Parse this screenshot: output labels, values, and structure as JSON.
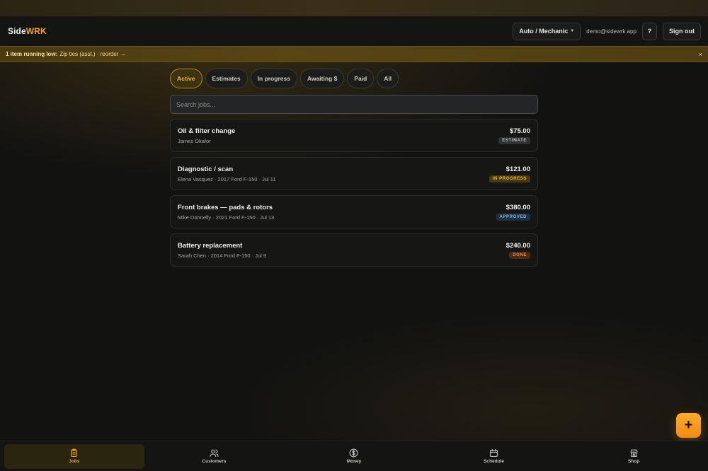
{
  "brand": {
    "part1": "Side",
    "part2": "WRK"
  },
  "header": {
    "trade_label": "Auto / Mechanic",
    "email": "demo@sidewrk.app",
    "help_label": "?",
    "signout_label": "Sign out"
  },
  "alert": {
    "strong": "1 item running low:",
    "text": "Zip ties (asst.) · reorder →",
    "close": "×"
  },
  "tabs": [
    {
      "label": "Active",
      "active": true
    },
    {
      "label": "Estimates"
    },
    {
      "label": "In progress"
    },
    {
      "label": "Awaiting $"
    },
    {
      "label": "Paid"
    },
    {
      "label": "All"
    }
  ],
  "search": {
    "placeholder": "Search jobs..."
  },
  "jobs": [
    {
      "title": "Oil & filter change",
      "subtitle": "James Okafor",
      "price": "$75.00",
      "status": "ESTIMATE",
      "status_bg": "#2f3133",
      "status_fg": "#b9bcc0"
    },
    {
      "title": "Diagnostic / scan",
      "subtitle": "Elena Vasquez · 2017 Ford F-150 · Jul 11",
      "price": "$121.00",
      "status": "IN PROGRESS",
      "status_bg": "#4a3a10",
      "status_fg": "#f2b630"
    },
    {
      "title": "Front brakes — pads & rotors",
      "subtitle": "Mike Donnelly · 2021 Ford F-150 · Jul 13",
      "price": "$380.00",
      "status": "APPROVED",
      "status_bg": "#1f3245",
      "status_fg": "#7fb2e5"
    },
    {
      "title": "Battery replacement",
      "subtitle": "Sarah Chen · 2014 Ford F-150 · Jul 9",
      "price": "$240.00",
      "status": "DONE",
      "status_bg": "#4a2a14",
      "status_fg": "#f08a3c"
    }
  ],
  "fab": {
    "label": "+"
  },
  "nav": [
    {
      "label": "Jobs",
      "icon": "clipboard-icon",
      "active": true
    },
    {
      "label": "Customers",
      "icon": "users-icon"
    },
    {
      "label": "Money",
      "icon": "dollar-circle-icon"
    },
    {
      "label": "Schedule",
      "icon": "calendar-icon"
    },
    {
      "label": "Shop",
      "icon": "storefront-icon"
    }
  ],
  "colors": {
    "accent": "#f5a623",
    "background": "#121211"
  }
}
